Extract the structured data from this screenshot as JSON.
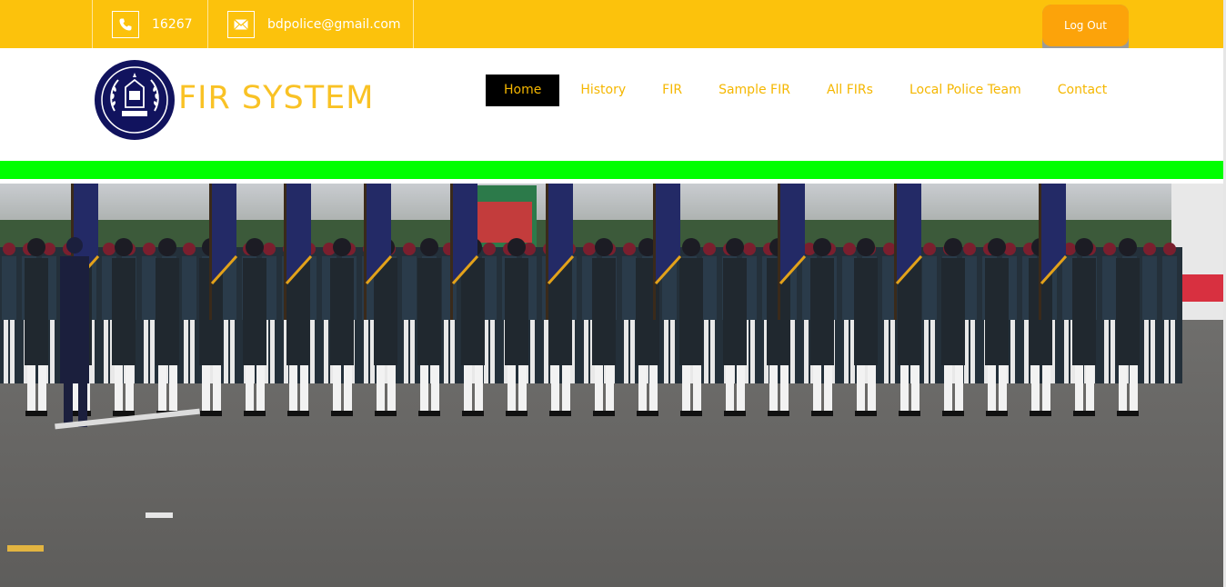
{
  "topbar": {
    "phone": "16267",
    "email": "bdpolice@gmail.com",
    "logout_label": "Log Out",
    "phone_icon": "phone-icon",
    "email_icon": "envelope-icon"
  },
  "header": {
    "brand": "FIR SYSTEM",
    "logo": "police-emblem-logo"
  },
  "nav": {
    "items": [
      {
        "label": "Home"
      },
      {
        "label": "History"
      },
      {
        "label": "FIR"
      },
      {
        "label": "Sample FIR"
      },
      {
        "label": "All FIRs"
      },
      {
        "label": "Local Police Team"
      },
      {
        "label": "Contact"
      }
    ]
  },
  "colors": {
    "topbar": "#fcc20c",
    "accent": "#f5b700",
    "logout": "#fca30a",
    "divider": "#00ff00",
    "logo_bg": "#11135e"
  }
}
